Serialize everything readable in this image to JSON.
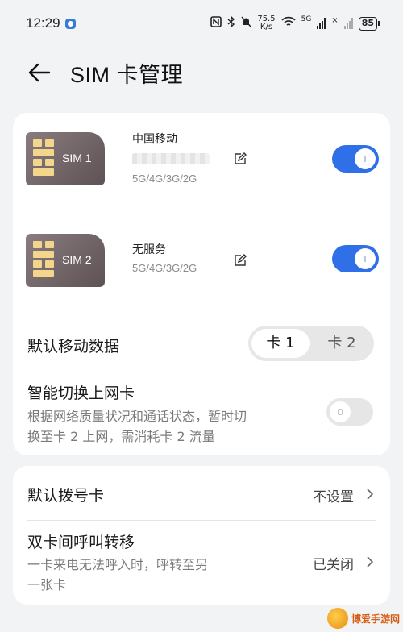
{
  "status_bar": {
    "time": "12:29",
    "speed_value": "75.5",
    "speed_unit": "K/s",
    "network_tag": "5G",
    "battery": "85"
  },
  "header": {
    "title": "SIM 卡管理"
  },
  "sims": [
    {
      "chip_label": "SIM 1",
      "name": "中国移动",
      "network": "5G/4G/3G/2G",
      "enabled": true
    },
    {
      "chip_label": "SIM 2",
      "name": "无服务",
      "network": "5G/4G/3G/2G",
      "enabled": true
    }
  ],
  "default_data": {
    "title": "默认移动数据",
    "options": [
      "卡 1",
      "卡 2"
    ],
    "selected": "卡 1"
  },
  "smart_switch": {
    "title": "智能切换上网卡",
    "description_line1": "根据网络质量状况和通话状态，暂时切",
    "description_line2": "换至卡 2 上网，需消耗卡 2 流量",
    "enabled": false
  },
  "default_dial": {
    "title": "默认拨号卡",
    "value": "不设置"
  },
  "call_forward": {
    "title": "双卡间呼叫转移",
    "description_line1": "一卡来电无法呼入时，呼转至另",
    "description_line2": "一张卡",
    "value": "已关闭"
  },
  "watermark": {
    "text": "博爱手游网"
  },
  "colors": {
    "accent": "#2f6fe8",
    "background": "#f1f3f5",
    "card": "#ffffff"
  }
}
